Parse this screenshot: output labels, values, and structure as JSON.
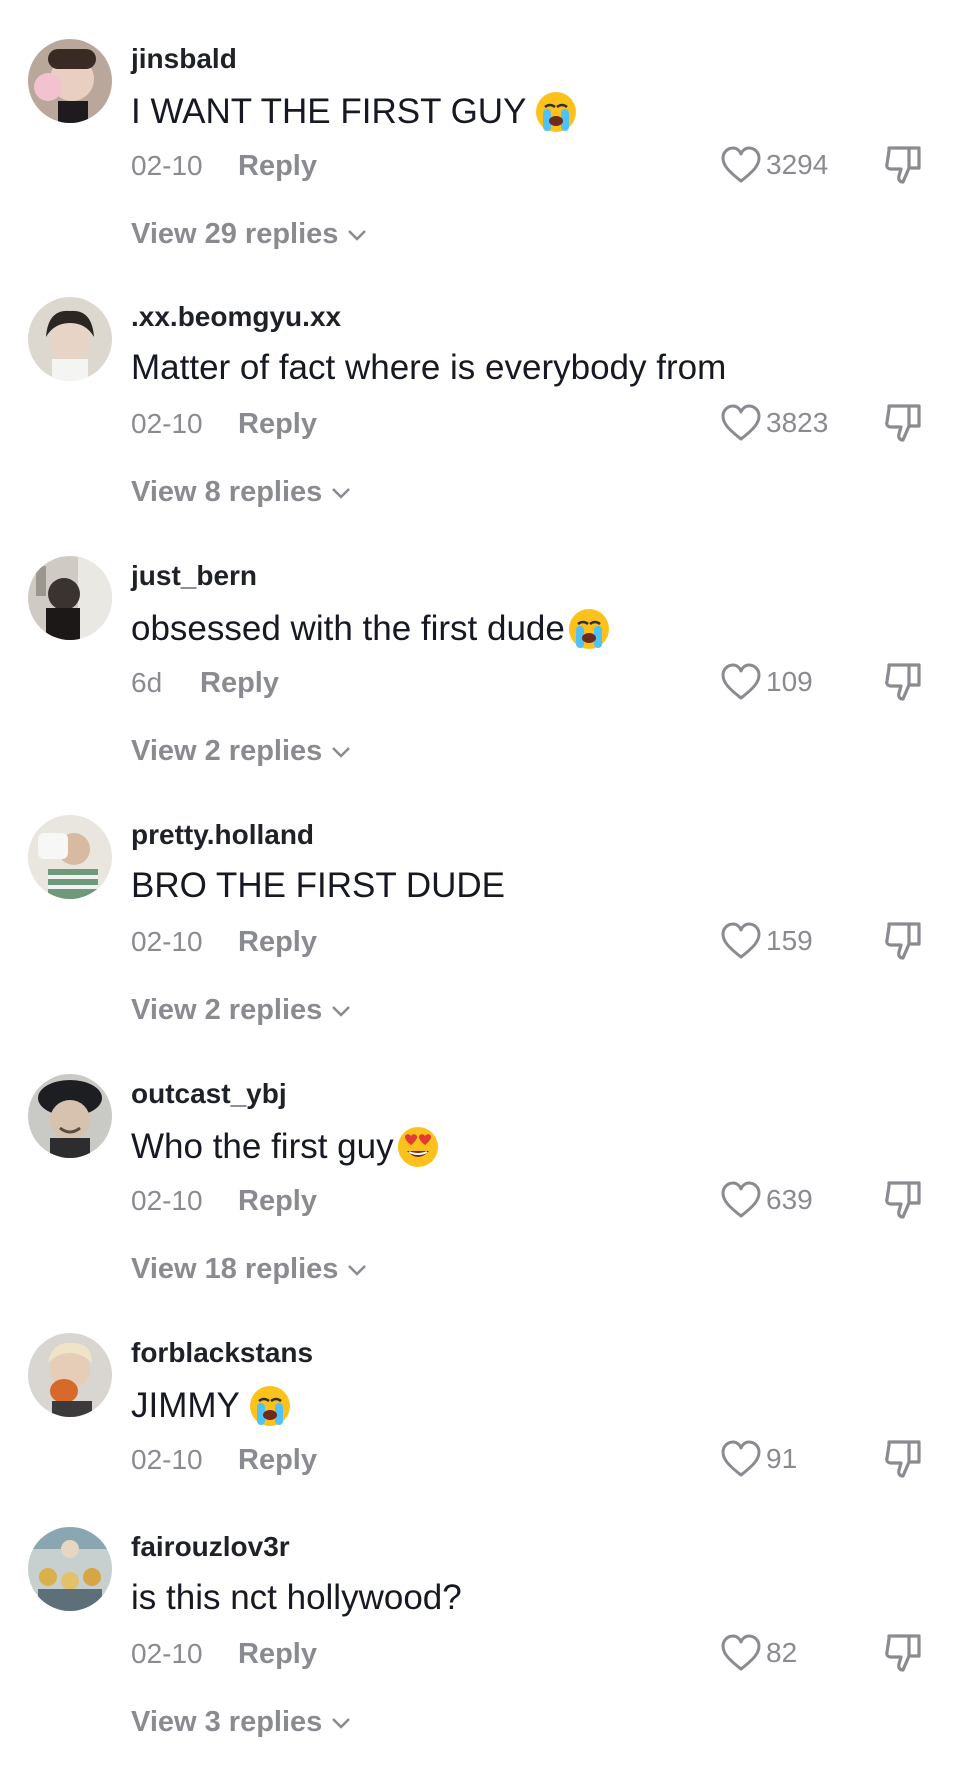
{
  "comments": [
    {
      "username": "jinsbald",
      "text": "I WANT THE FIRST GUY",
      "emoji": "loudly-crying-face",
      "date": "02-10",
      "reply_label": "Reply",
      "likes": "3294",
      "view_replies": "View 29 replies"
    },
    {
      "username": ".xx.beomgyu.xx",
      "text": "Matter of fact where is everybody from",
      "emoji": "",
      "date": "02-10",
      "reply_label": "Reply",
      "likes": "3823",
      "view_replies": "View 8 replies"
    },
    {
      "username": "just_bern",
      "text": "obsessed with the first dude",
      "emoji": "loudly-crying-face",
      "date": "6d",
      "reply_label": "Reply",
      "likes": "109",
      "view_replies": "View 2 replies"
    },
    {
      "username": "pretty.holland",
      "text": "BRO THE FIRST DUDE",
      "emoji": "",
      "date": "02-10",
      "reply_label": "Reply",
      "likes": "159",
      "view_replies": "View 2 replies"
    },
    {
      "username": "outcast_ybj",
      "text": "Who the first guy",
      "emoji": "smiling-face-with-heart-eyes",
      "date": "02-10",
      "reply_label": "Reply",
      "likes": "639",
      "view_replies": "View 18 replies"
    },
    {
      "username": "forblackstans",
      "text": "JIMMY",
      "emoji": "loudly-crying-face",
      "date": "02-10",
      "reply_label": "Reply",
      "likes": "91",
      "view_replies": ""
    },
    {
      "username": "fairouzlov3r",
      "text": "is this nct hollywood?",
      "emoji": "",
      "date": "02-10",
      "reply_label": "Reply",
      "likes": "82",
      "view_replies": "View 3 replies"
    }
  ],
  "colors": {
    "muted": "#8a8b91",
    "text": "#161823",
    "background": "#ffffff"
  }
}
